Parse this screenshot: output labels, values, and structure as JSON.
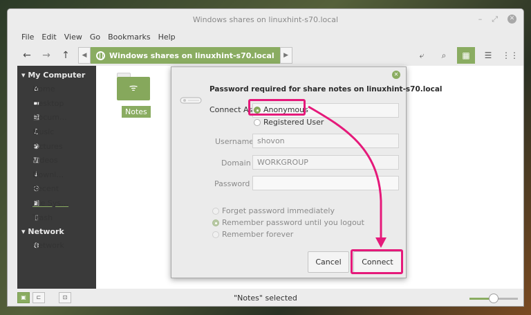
{
  "window": {
    "title": "Windows shares on linuxhint-s70.local",
    "controls": {
      "minimize": "–",
      "maximize": "⤢",
      "close": "✕"
    }
  },
  "menu": [
    "File",
    "Edit",
    "View",
    "Go",
    "Bookmarks",
    "Help"
  ],
  "toolbar": {
    "back": "←",
    "forward": "→",
    "up": "↑",
    "path_prev": "◀",
    "path_next": "▶",
    "location": "Windows shares on linuxhint-s70.local",
    "tools": [
      "⤶",
      "⌕",
      "▦",
      "☰",
      "⋮⋮"
    ]
  },
  "sidebar": {
    "my_computer": "My Computer",
    "items": [
      {
        "label": "Home",
        "icon": "home-icon",
        "glyph": "⌂"
      },
      {
        "label": "Desktop",
        "icon": "desktop-icon",
        "glyph": "▬"
      },
      {
        "label": "Docum…",
        "icon": "documents-icon",
        "glyph": "▤"
      },
      {
        "label": "Music",
        "icon": "music-icon",
        "glyph": "♫"
      },
      {
        "label": "Pictures",
        "icon": "camera-icon",
        "glyph": "◉"
      },
      {
        "label": "Videos",
        "icon": "film-icon",
        "glyph": "▥"
      },
      {
        "label": "Downl…",
        "icon": "download-icon",
        "glyph": "↓"
      },
      {
        "label": "Recent",
        "icon": "clock-icon",
        "glyph": "◷"
      },
      {
        "label": "File Sys…",
        "icon": "drive-icon",
        "glyph": "▣"
      },
      {
        "label": "Trash",
        "icon": "trash-icon",
        "glyph": "▯"
      }
    ],
    "network": "Network",
    "network_items": [
      {
        "label": "Network",
        "icon": "globe-icon",
        "glyph": "◍"
      }
    ]
  },
  "content": {
    "folder_label": "Notes",
    "folder_glyph": "ᯤ"
  },
  "status": {
    "text": "\"Notes\" selected",
    "zoom_level": 0.5,
    "pane_buttons": [
      "▣",
      "⊏",
      "⊡"
    ]
  },
  "dialog": {
    "title": "Password required for share notes on linuxhint-s70.local",
    "connect_as_label": "Connect As",
    "anonymous": "Anonymous",
    "registered": "Registered User",
    "username_label": "Username",
    "username_value": "shovon",
    "domain_label": "Domain",
    "domain_value": "WORKGROUP",
    "password_label": "Password",
    "password_value": "",
    "forget_option": "Forget password immediately",
    "remember_logout_option": "Remember password until you logout",
    "remember_forever_option": "Remember forever",
    "cancel": "Cancel",
    "connect": "Connect",
    "close": "✕"
  },
  "annotation_color": "#e5197a",
  "accent_color": "#8aac61"
}
